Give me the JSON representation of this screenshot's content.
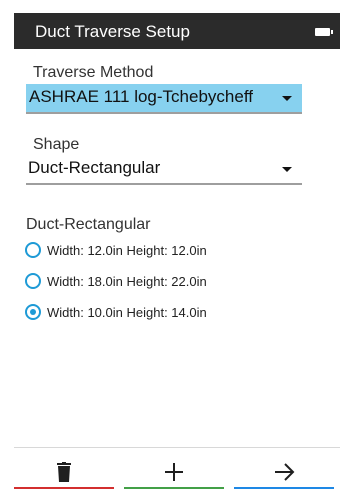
{
  "header": {
    "title": "Duct Traverse Setup",
    "battery_icon": "battery-icon"
  },
  "traverse_method": {
    "label": "Traverse Method",
    "value": "ASHRAE 111 log-Tchebycheff"
  },
  "shape": {
    "label": "Shape",
    "value": "Duct-Rectangular"
  },
  "duct_list": {
    "heading": "Duct-Rectangular",
    "items": [
      {
        "label": "Width: 12.0in Height: 12.0in",
        "selected": false
      },
      {
        "label": "Width: 18.0in Height: 22.0in",
        "selected": false
      },
      {
        "label": "Width: 10.0in Height: 14.0in",
        "selected": true
      }
    ]
  },
  "toolbar": {
    "delete_icon": "trash-icon",
    "add_icon": "plus-icon",
    "next_icon": "arrow-right-icon",
    "colors": {
      "delete": "#d32f2f",
      "add": "#43a047",
      "next": "#1e88e5"
    }
  },
  "colors": {
    "accent": "#1e9ad6",
    "highlight": "#87d1ef",
    "titlebar": "#2b2b2b"
  }
}
